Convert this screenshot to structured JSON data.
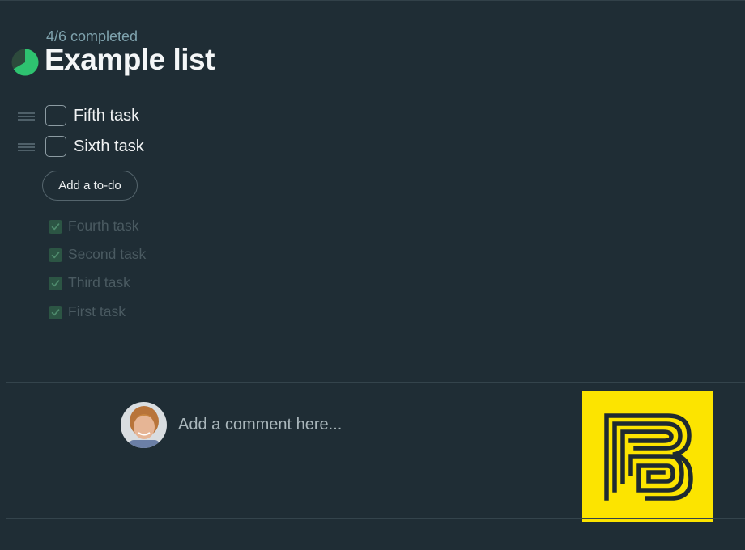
{
  "list": {
    "progress_text": "4/6 completed",
    "completed": 4,
    "total": 6,
    "title": "Example list"
  },
  "open_todos": [
    {
      "label": "Fifth task"
    },
    {
      "label": "Sixth task"
    }
  ],
  "add_button_label": "Add a to-do",
  "completed_todos": [
    {
      "label": "Fourth task"
    },
    {
      "label": "Second task"
    },
    {
      "label": "Third task"
    },
    {
      "label": "First task"
    }
  ],
  "comment": {
    "placeholder": "Add a comment here...",
    "value": ""
  },
  "icons": {
    "progress": "progress-pie-icon",
    "drag": "drag-handle-icon",
    "check": "checkmark-icon",
    "avatar": "user-avatar",
    "logo": "brand-logo"
  },
  "colors": {
    "background": "#1f2d35",
    "accent_green": "#2ec270",
    "logo_yellow": "#fce400",
    "completed_check": "#2c5544"
  }
}
